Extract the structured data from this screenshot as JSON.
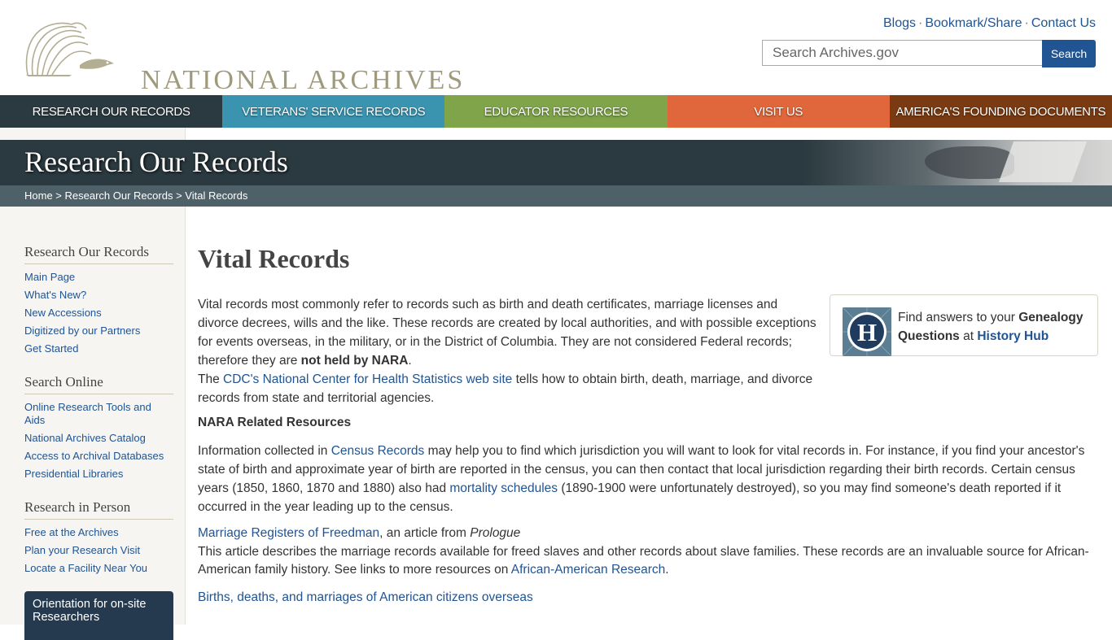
{
  "header": {
    "logo_text": "NATIONAL ARCHIVES",
    "util_links": [
      "Blogs",
      "Bookmark/Share",
      "Contact Us"
    ],
    "search_placeholder": "Search Archives.gov",
    "search_button": "Search"
  },
  "nav": [
    {
      "label": "Research Our Records",
      "color": "#2b3a40"
    },
    {
      "label": "Veterans' Service Records",
      "color": "#3a94b0"
    },
    {
      "label": "Educator Resources",
      "color": "#7fa44a"
    },
    {
      "label": "Visit Us",
      "color": "#e0673b"
    },
    {
      "label": "America's Founding Documents",
      "color": "#7a3a12"
    }
  ],
  "banner": {
    "title": "Research Our Records",
    "breadcrumb": {
      "home": "Home",
      "sep1": " > ",
      "section": "Research Our Records",
      "sep2": " > ",
      "current": "Vital Records"
    }
  },
  "sidebar": {
    "sections": [
      {
        "heading": "Research Our Records",
        "links": [
          "Main Page",
          "What's New?",
          "New Accessions",
          "Digitized by our Partners",
          "Get Started"
        ]
      },
      {
        "heading": "Search Online",
        "links": [
          "Online Research Tools and Aids",
          "National Archives Catalog",
          "Access to Archival Databases",
          "Presidential Libraries"
        ]
      },
      {
        "heading": "Research in Person",
        "links": [
          "Free at the Archives",
          "Plan your Research Visit",
          "Locate a Facility Near You"
        ]
      }
    ],
    "orientation": "Orientation for on-site Researchers"
  },
  "content": {
    "title": "Vital Records",
    "intro_text": "Vital records most commonly refer to records such as birth and death certificates, marriage licenses and divorce decrees, wills and the like. These records are created by local authorities, and with possible exceptions for events overseas, in the military, or in the District of Columbia. They are not considered Federal records; therefore they are ",
    "intro_bold": "not held by NARA",
    "intro_end": ".",
    "cdc_pre": "The ",
    "cdc_link": "CDC's National Center for Health Statistics web site",
    "cdc_post": " tells how to obtain birth, death, marriage, and divorce records from state and territorial agencies.",
    "related_heading": "NARA Related Resources",
    "census_pre": "Information collected in ",
    "census_link": "Census Records",
    "census_mid": " may help you to find which jurisdiction you will want to look for vital records in. For instance, if you find your ancestor's state of birth and approximate year of birth are reported in the census, you can then contact that local jurisdiction regarding their birth records. Certain census years (1850, 1860, 1870 and 1880) also had ",
    "mortality_link": "mortality schedules",
    "census_end": " (1890-1900 were unfortunately destroyed), so you may find someone's death reported if it occurred in the year leading up to the census.",
    "marriage_link": "Marriage Registers of Freedman",
    "marriage_mid": ", an article from ",
    "marriage_italic": "Prologue",
    "marriage_desc": "This article describes the marriage records available for freed slaves and other records about slave families. These records are an invaluable source for African-American family history. See links to more resources on ",
    "aa_link": "African-American Research",
    "aa_end": ".",
    "overseas_link": "Births, deaths, and marriages of American citizens overseas"
  },
  "hub": {
    "pre": "Find answers to your ",
    "bold": "Genealogy Questions",
    "mid": " at ",
    "link": "History Hub",
    "logo_letter": "H"
  }
}
